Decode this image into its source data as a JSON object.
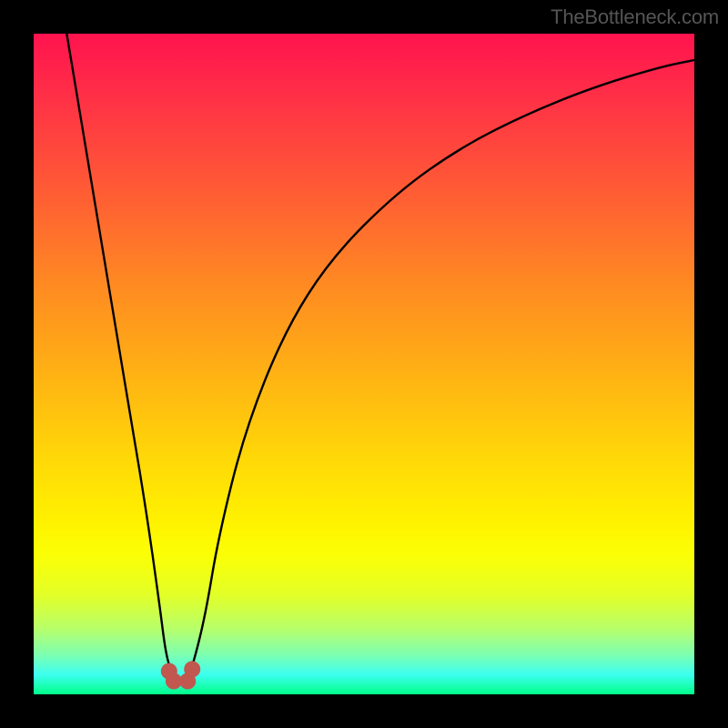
{
  "watermark": "TheBottleneck.com",
  "chart_data": {
    "type": "line",
    "title": "",
    "xlabel": "",
    "ylabel": "",
    "xlim": [
      0,
      100
    ],
    "ylim": [
      0,
      100
    ],
    "series": [
      {
        "name": "bottleneck-curve",
        "x": [
          5,
          7,
          9,
          11,
          13,
          15,
          17,
          19,
          20,
          21,
          22,
          23,
          24,
          26,
          28,
          32,
          38,
          45,
          55,
          65,
          75,
          85,
          95,
          100
        ],
        "y": [
          100,
          88,
          76,
          64,
          52,
          40,
          28,
          14,
          6,
          3,
          2,
          2,
          4,
          12,
          24,
          40,
          55,
          66,
          76,
          83,
          88,
          92,
          95,
          96
        ]
      }
    ],
    "markers": [
      {
        "name": "valley-marker-left",
        "x": 20.5,
        "y": 3.5
      },
      {
        "name": "valley-marker-bottom-left",
        "x": 21.2,
        "y": 2.0
      },
      {
        "name": "valley-marker-bottom-right",
        "x": 23.3,
        "y": 2.0
      },
      {
        "name": "valley-marker-right",
        "x": 24.0,
        "y": 3.8
      }
    ],
    "colors": {
      "curve": "#000000",
      "marker": "#c1574f",
      "gradient_top": "#ff134e",
      "gradient_bottom": "#00ff88"
    }
  }
}
